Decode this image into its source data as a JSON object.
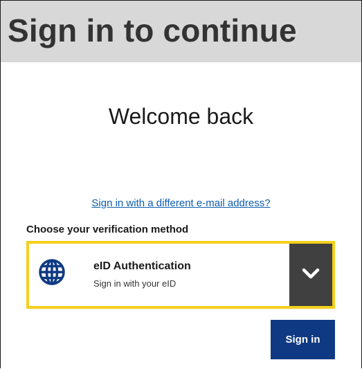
{
  "header": {
    "title": "Sign in to continue"
  },
  "welcome": {
    "text": "Welcome back"
  },
  "alt_link": {
    "label": "Sign in with a different e-mail address?"
  },
  "verification": {
    "label": "Choose your verification method",
    "selected": {
      "icon": "globe-icon",
      "name": "eID Authentication",
      "description": "Sign in with your eID"
    },
    "toggle_icon": "chevron-down-icon"
  },
  "actions": {
    "signin_label": "Sign in"
  },
  "colors": {
    "header_bg": "#d8d8d8",
    "link": "#0b5cad",
    "focus_border": "#f5d01c",
    "toggle_bg": "#404040",
    "primary_button": "#0f3a83",
    "globe": "#0f3a83"
  }
}
